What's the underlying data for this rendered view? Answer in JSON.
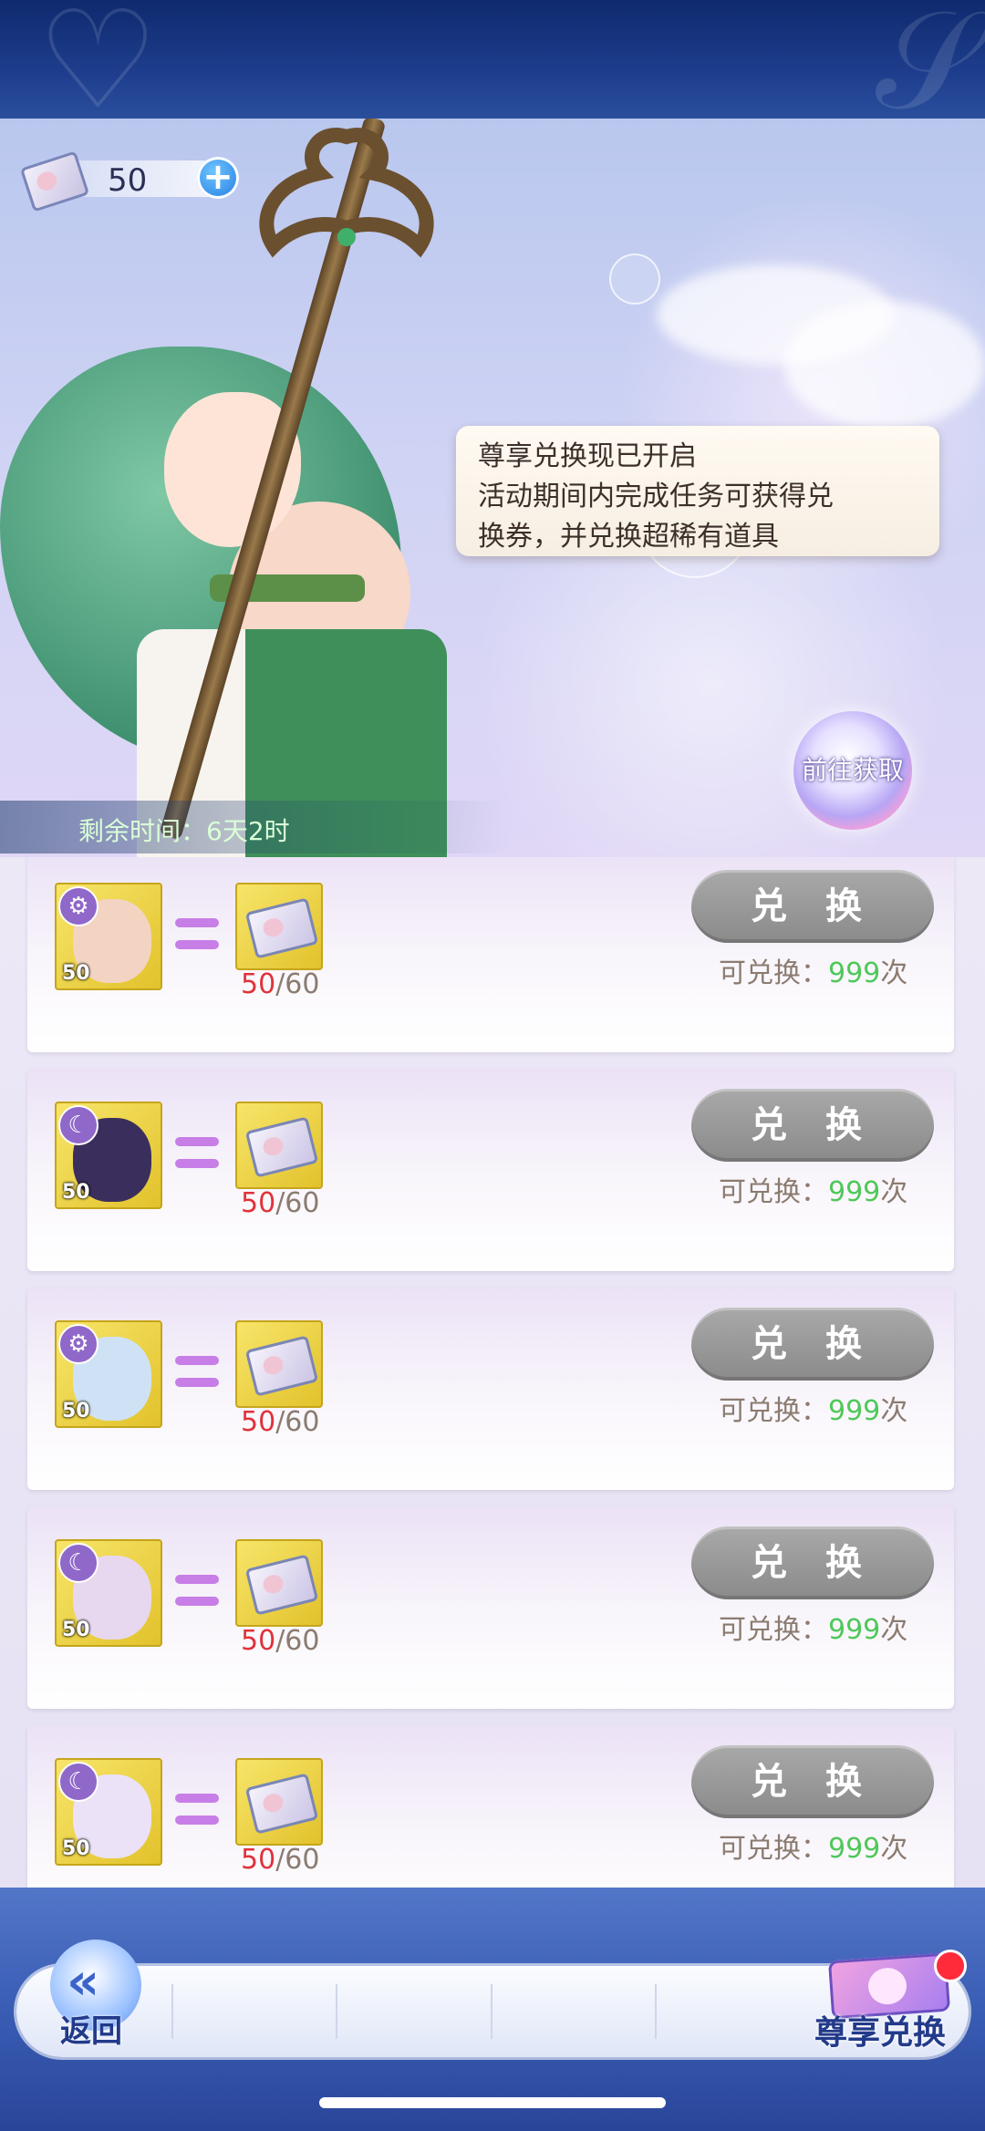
{
  "currency": {
    "amount": "50",
    "add_label": "+"
  },
  "speech_bubble": {
    "lines": [
      "尊享兑换现已开启",
      "活动期间内完成任务可获得兑",
      "换券，并兑换超稀有道具"
    ]
  },
  "go_obtain_label": "前往获取",
  "remaining_time": "剩余时间：6天2时",
  "exchange_items": [
    {
      "level": "50",
      "badge": "gear-icon",
      "badge_glyph": "⚙",
      "owned": "50",
      "required": "/60",
      "button": "兑 换",
      "limit_prefix": "可兑换：",
      "limit_count": "999",
      "limit_suffix": "次",
      "portrait_color": "#f3d4c2"
    },
    {
      "level": "50",
      "badge": "moon-icon",
      "badge_glyph": "☾",
      "owned": "50",
      "required": "/60",
      "button": "兑 换",
      "limit_prefix": "可兑换：",
      "limit_count": "999",
      "limit_suffix": "次",
      "portrait_color": "#3a2f5c"
    },
    {
      "level": "50",
      "badge": "gear-icon",
      "badge_glyph": "⚙",
      "owned": "50",
      "required": "/60",
      "button": "兑 换",
      "limit_prefix": "可兑换：",
      "limit_count": "999",
      "limit_suffix": "次",
      "portrait_color": "#cfe2f5"
    },
    {
      "level": "50",
      "badge": "moon-icon",
      "badge_glyph": "☾",
      "owned": "50",
      "required": "/60",
      "button": "兑 换",
      "limit_prefix": "可兑换：",
      "limit_count": "999",
      "limit_suffix": "次",
      "portrait_color": "#e7d8ef"
    },
    {
      "level": "50",
      "badge": "moon-icon",
      "badge_glyph": "☾",
      "owned": "50",
      "required": "/60",
      "button": "兑 换",
      "limit_prefix": "可兑换：",
      "limit_count": "999",
      "limit_suffix": "次",
      "portrait_color": "#ebe2f7"
    }
  ],
  "bottom_nav": {
    "back_label": "返回",
    "vip_exchange_label": "尊享兑换"
  },
  "colors": {
    "owned_count": "#e0323a",
    "limit_count": "#4fc85a",
    "equals_sign": "#c77ee6",
    "notification_dot": "#ff2b3b"
  }
}
